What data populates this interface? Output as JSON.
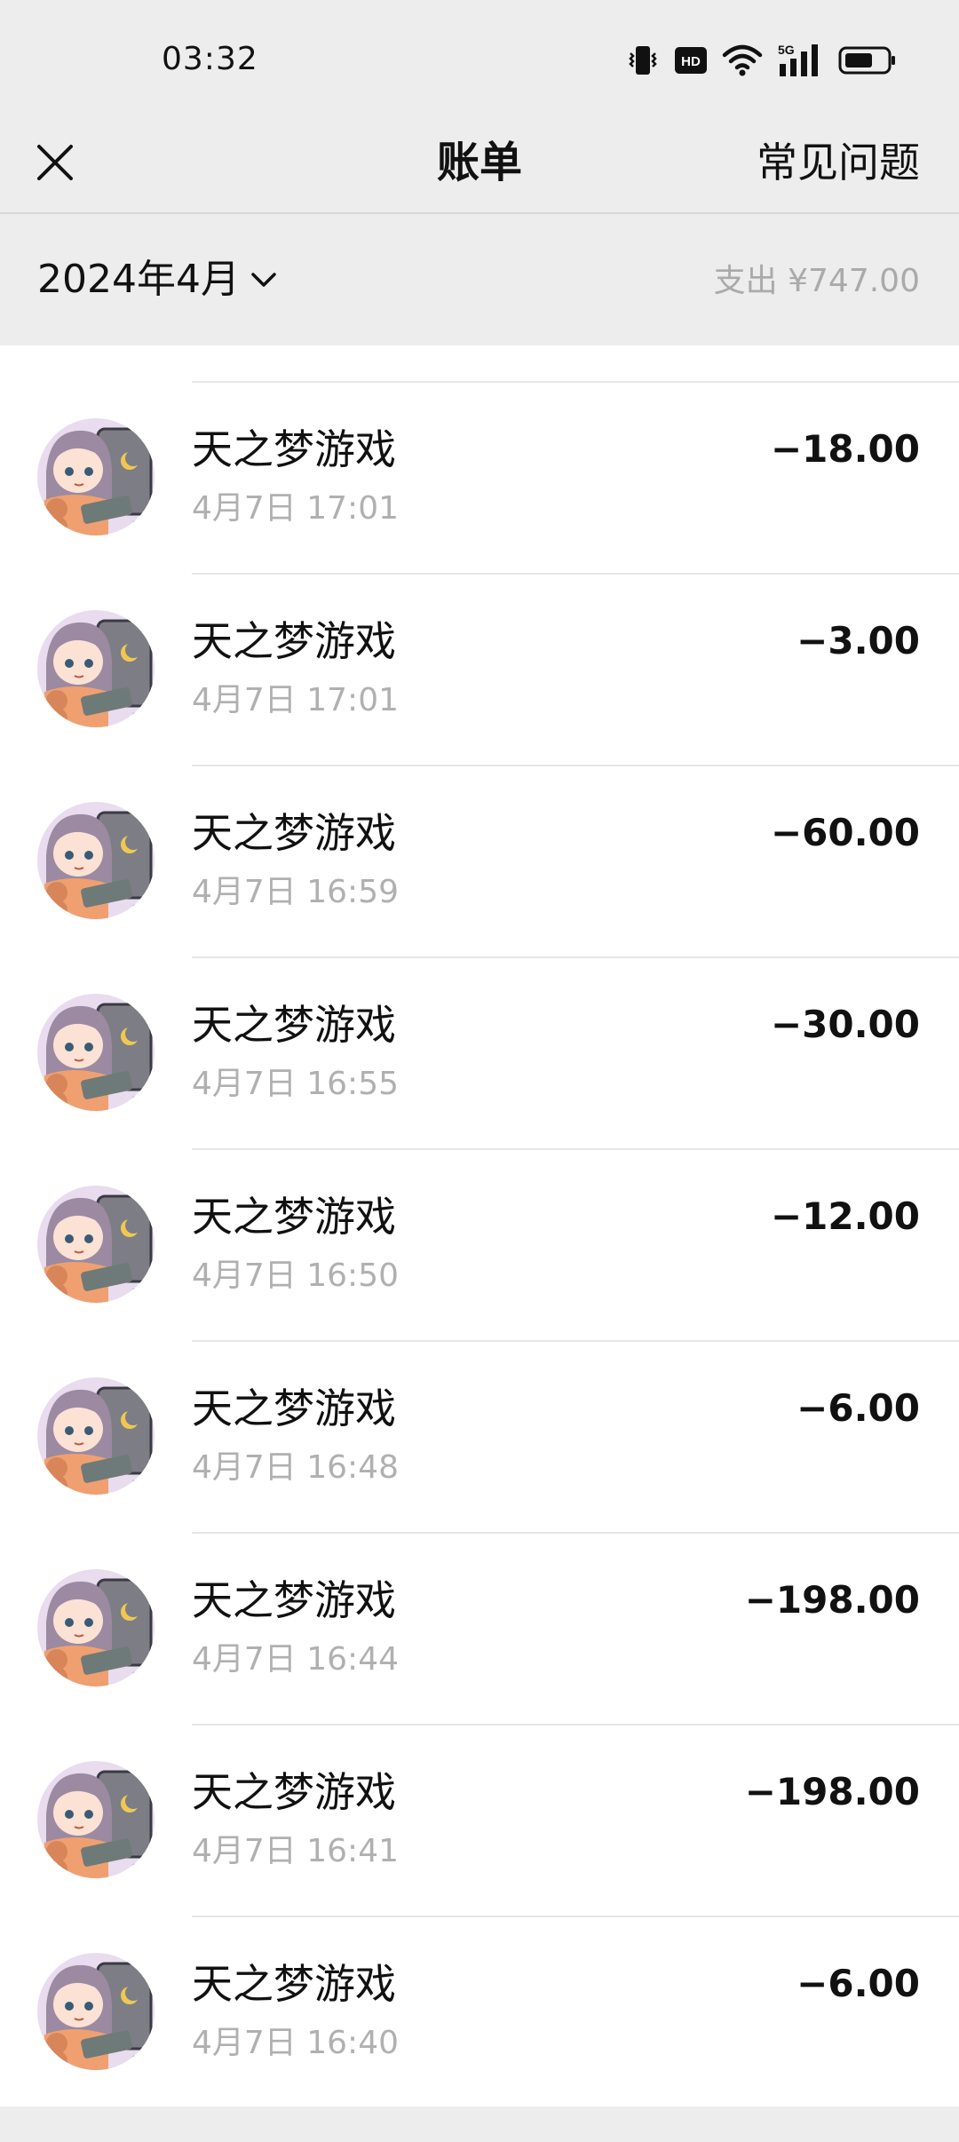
{
  "status_bar": {
    "time": "03:32",
    "icons": [
      "vibrate-icon",
      "hd-icon",
      "wifi-icon",
      "signal-5g-icon",
      "battery-icon"
    ],
    "network_label": "5G",
    "hd_label": "HD"
  },
  "header": {
    "title": "账单",
    "faq_label": "常见问题",
    "close_icon": "close-icon"
  },
  "month_bar": {
    "month": "2024年4月",
    "expense_summary": "支出 ¥747.00"
  },
  "transactions": [
    {
      "merchant": "天之梦游戏",
      "time": "4月7日 17:01",
      "amount": "−18.00"
    },
    {
      "merchant": "天之梦游戏",
      "time": "4月7日 17:01",
      "amount": "−3.00"
    },
    {
      "merchant": "天之梦游戏",
      "time": "4月7日 16:59",
      "amount": "−60.00"
    },
    {
      "merchant": "天之梦游戏",
      "time": "4月7日 16:55",
      "amount": "−30.00"
    },
    {
      "merchant": "天之梦游戏",
      "time": "4月7日 16:50",
      "amount": "−12.00"
    },
    {
      "merchant": "天之梦游戏",
      "time": "4月7日 16:48",
      "amount": "−6.00"
    },
    {
      "merchant": "天之梦游戏",
      "time": "4月7日 16:44",
      "amount": "−198.00"
    },
    {
      "merchant": "天之梦游戏",
      "time": "4月7日 16:41",
      "amount": "−198.00"
    },
    {
      "merchant": "天之梦游戏",
      "time": "4月7日 16:40",
      "amount": "−6.00"
    }
  ],
  "colors": {
    "background": "#ededed",
    "list_background": "#ffffff",
    "text_primary": "#111111",
    "text_secondary": "#b0b0b0",
    "divider": "#e6e6e6"
  }
}
